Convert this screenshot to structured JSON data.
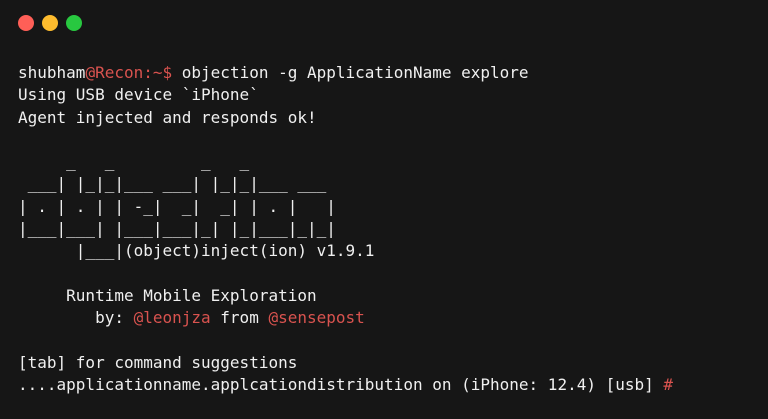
{
  "window": {
    "controls": {
      "close_color": "#ff5f57",
      "minimize_color": "#febc2e",
      "maximize_color": "#28c840"
    }
  },
  "terminal": {
    "prompt": {
      "user": "shubham",
      "host": "@Recon:~$",
      "command": " objection -g ApplicationName explore"
    },
    "output": [
      "Using USB device `iPhone`",
      "Agent injected and responds ok!"
    ],
    "banner": [
      "     _   _         _   _",
      " ___| |_|_|___ ___| |_|_|___ ___",
      "| . | . | | -_|  _|  _| | . |   |",
      "|___|___| |___|___|_| |_|___|_|_|",
      "      |___|(object)inject(ion) v1.9.1"
    ],
    "tagline": "     Runtime Mobile Exploration",
    "credits": {
      "prefix": "        by: ",
      "author1": "@leonjza",
      "middle": " from ",
      "author2": "@sensepost"
    },
    "hint": "[tab] for command suggestions",
    "repl_prompt": {
      "context": "....applicationname.applcationdistribution on (iPhone: 12.4) [usb] ",
      "symbol": "#"
    }
  },
  "colors": {
    "background": "#161616",
    "text": "#f0f0f0",
    "accent_red": "#d9534f"
  }
}
